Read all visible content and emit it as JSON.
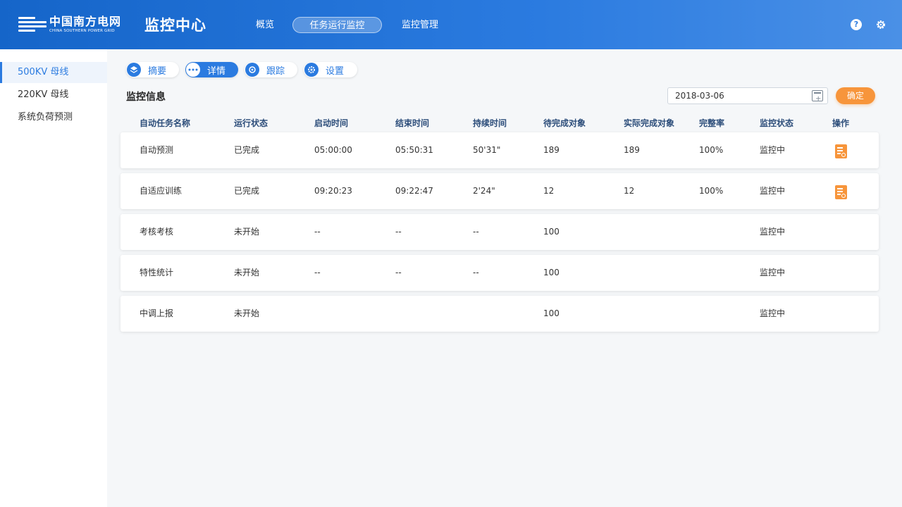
{
  "brand": {
    "logo_cn": "中国南方电网",
    "logo_en": "CHINA SOUTHERN POWER GRID",
    "app_title": "监控中心"
  },
  "nav": [
    "概览",
    "任务运行监控",
    "监控管理"
  ],
  "nav_active": "任务运行监控",
  "header_icons": [
    "help-icon",
    "gear-icon"
  ],
  "sidebar": {
    "items": [
      "500KV 母线",
      "220KV 母线",
      "系统负荷预测"
    ],
    "active": "500KV 母线"
  },
  "tabs": [
    {
      "label": "摘要",
      "icon": "layers-icon"
    },
    {
      "label": "详情",
      "icon": "more-icon"
    },
    {
      "label": "跟踪",
      "icon": "target-icon"
    },
    {
      "label": "设置",
      "icon": "gear-icon"
    }
  ],
  "tab_active": "详情",
  "section_title": "监控信息",
  "date_value": "2018-03-06",
  "confirm_label": "确定",
  "table": {
    "headers": [
      "自动任务名称",
      "运行状态",
      "启动时间",
      "结束时间",
      "持续时间",
      "待完成对象",
      "实际完成对象",
      "完整率",
      "监控状态",
      "操作"
    ],
    "rows": [
      {
        "name": "自动预测",
        "status": "已完成",
        "start": "05:00:00",
        "end": "05:50:31",
        "duration": "50'31\"",
        "pending": "189",
        "done": "189",
        "rate": "100%",
        "monitor": "监控中",
        "has_action": true
      },
      {
        "name": "自适应训练",
        "status": "已完成",
        "start": "09:20:23",
        "end": "09:22:47",
        "duration": "2'24\"",
        "pending": "12",
        "done": "12",
        "rate": "100%",
        "monitor": "监控中",
        "has_action": true
      },
      {
        "name": "考核考核",
        "status": "未开始",
        "start": "--",
        "end": "--",
        "duration": "--",
        "pending": "100",
        "done": "",
        "rate": "",
        "monitor": "监控中",
        "has_action": false
      },
      {
        "name": "特性统计",
        "status": "未开始",
        "start": "--",
        "end": "--",
        "duration": "--",
        "pending": "100",
        "done": "",
        "rate": "",
        "monitor": "监控中",
        "has_action": false
      },
      {
        "name": "中调上报",
        "status": "未开始",
        "start": "",
        "end": "",
        "duration": "",
        "pending": "100",
        "done": "",
        "rate": "",
        "monitor": "监控中",
        "has_action": false
      }
    ]
  },
  "colors": {
    "primary": "#2b7be0",
    "accent": "#f7953b",
    "header_text": "#2c4d7a"
  }
}
